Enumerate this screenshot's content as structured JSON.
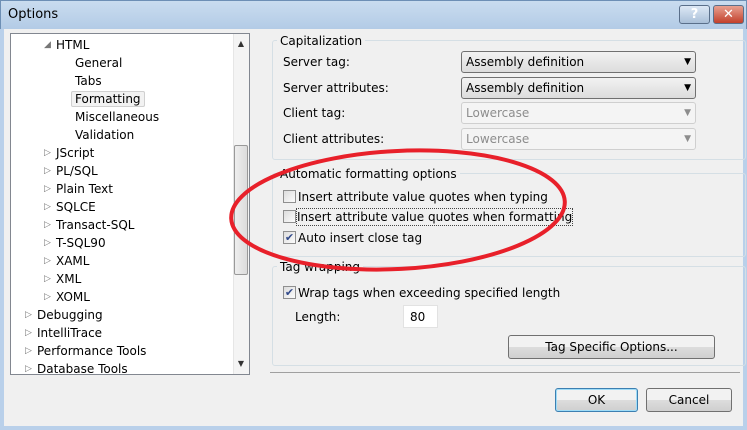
{
  "window": {
    "title": "Options",
    "help_label": "?",
    "close_label": "✕"
  },
  "tree": {
    "items": [
      {
        "label": "HTML",
        "level": 1,
        "arrow": "◢"
      },
      {
        "label": "General",
        "level": 2
      },
      {
        "label": "Tabs",
        "level": 2
      },
      {
        "label": "Formatting",
        "level": 2,
        "selected": true
      },
      {
        "label": "Miscellaneous",
        "level": 2
      },
      {
        "label": "Validation",
        "level": 2
      },
      {
        "label": "JScript",
        "level": 1,
        "arrow": "▷"
      },
      {
        "label": "PL/SQL",
        "level": 1,
        "arrow": "▷"
      },
      {
        "label": "Plain Text",
        "level": 1,
        "arrow": "▷"
      },
      {
        "label": "SQLCE",
        "level": 1,
        "arrow": "▷"
      },
      {
        "label": "Transact-SQL",
        "level": 1,
        "arrow": "▷"
      },
      {
        "label": "T-SQL90",
        "level": 1,
        "arrow": "▷"
      },
      {
        "label": "XAML",
        "level": 1,
        "arrow": "▷"
      },
      {
        "label": "XML",
        "level": 1,
        "arrow": "▷"
      },
      {
        "label": "XOML",
        "level": 1,
        "arrow": "▷"
      },
      {
        "label": "Debugging",
        "level": 0,
        "arrow": "▷"
      },
      {
        "label": "IntelliTrace",
        "level": 0,
        "arrow": "▷"
      },
      {
        "label": "Performance Tools",
        "level": 0,
        "arrow": "▷"
      },
      {
        "label": "Database Tools",
        "level": 0,
        "arrow": "▷"
      }
    ]
  },
  "capitalization": {
    "title": "Capitalization",
    "server_tag": {
      "label": "Server tag:",
      "value": "Assembly definition"
    },
    "server_attributes": {
      "label": "Server attributes:",
      "value": "Assembly definition"
    },
    "client_tag": {
      "label": "Client tag:",
      "value": "Lowercase"
    },
    "client_attributes": {
      "label": "Client attributes:",
      "value": "Lowercase"
    }
  },
  "auto": {
    "title": "Automatic formatting options",
    "typing": {
      "label": "Insert attribute value quotes when typing",
      "checked": false
    },
    "formatting": {
      "label": "Insert attribute value quotes when formatting",
      "checked": false
    },
    "close_tag": {
      "label": "Auto insert close tag",
      "checked": true
    }
  },
  "wrap": {
    "title": "Tag wrapping",
    "wrap_tags": {
      "label": "Wrap tags when exceeding specified length",
      "checked": true
    },
    "length_label": "Length:",
    "length_value": "80",
    "tag_specific_label": "Tag Specific Options..."
  },
  "buttons": {
    "ok": "OK",
    "cancel": "Cancel"
  },
  "annotation": {
    "color": "#e8202a"
  }
}
